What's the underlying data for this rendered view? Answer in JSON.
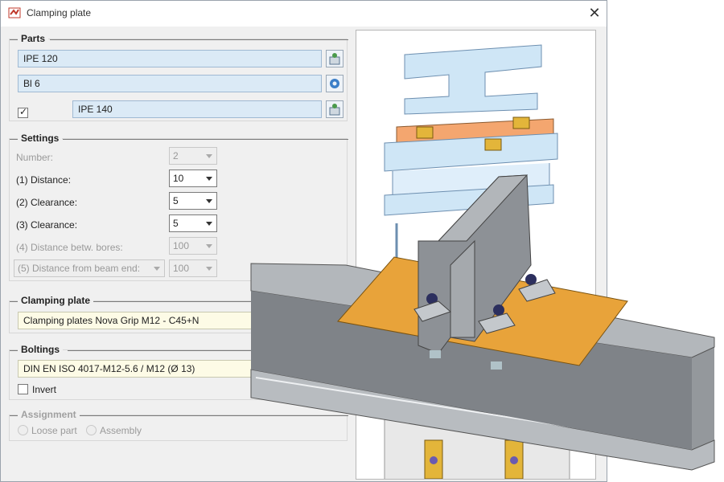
{
  "window": {
    "title": "Clamping plate"
  },
  "parts": {
    "title": "Parts",
    "beam1": "IPE 120",
    "plate": "Bl 6",
    "beam2_checked": true,
    "beam2": "IPE 140"
  },
  "settings": {
    "title": "Settings",
    "rows": [
      {
        "label": "Number:",
        "value": "2",
        "enabled": false
      },
      {
        "label": "(1) Distance:",
        "value": "10",
        "enabled": true
      },
      {
        "label": "(2) Clearance:",
        "value": "5",
        "enabled": true
      },
      {
        "label": "(3) Clearance:",
        "value": "5",
        "enabled": true
      },
      {
        "label": "(4) Distance betw. bores:",
        "value": "100",
        "enabled": false
      },
      {
        "label": "(5) Distance from beam end:",
        "value": "100",
        "enabled": false
      }
    ]
  },
  "clamping_plate": {
    "title": "Clamping plate",
    "value": "Clamping plates Nova Grip M12 - C45+N"
  },
  "boltings": {
    "title": "Boltings",
    "value": "DIN EN ISO 4017-M12-5.6 / M12 (Ø 13)",
    "invert_label": "Invert",
    "invert_checked": false
  },
  "assignment": {
    "title": "Assignment",
    "loose_part": "Loose part",
    "assembly": "Assembly"
  },
  "colors": {
    "steel": "#c9ccd0",
    "plate": "#e8a33a",
    "preview_blue": "#cfe6f6",
    "preview_orange": "#f4a66f"
  }
}
